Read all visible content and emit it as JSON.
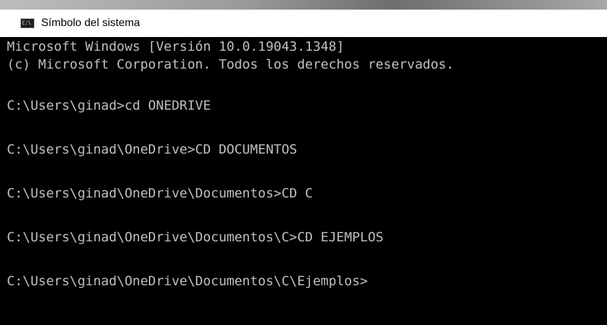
{
  "window": {
    "title": "Símbolo del sistema",
    "icon": "cmd-console-icon",
    "icon_text": "C:\\"
  },
  "console": {
    "lines": [
      "Microsoft Windows [Versión 10.0.19043.1348]",
      "(c) Microsoft Corporation. Todos los derechos reservados.",
      "C:\\Users\\ginad>cd ONEDRIVE",
      "C:\\Users\\ginad\\OneDrive>CD DOCUMENTOS",
      "C:\\Users\\ginad\\OneDrive\\Documentos>CD C",
      "C:\\Users\\ginad\\OneDrive\\Documentos\\C>CD EJEMPLOS",
      "C:\\Users\\ginad\\OneDrive\\Documentos\\C\\Ejemplos>"
    ]
  },
  "colors": {
    "console_background": "#000000",
    "console_text": "#c0c0c0",
    "titlebar_background": "#ffffff"
  }
}
